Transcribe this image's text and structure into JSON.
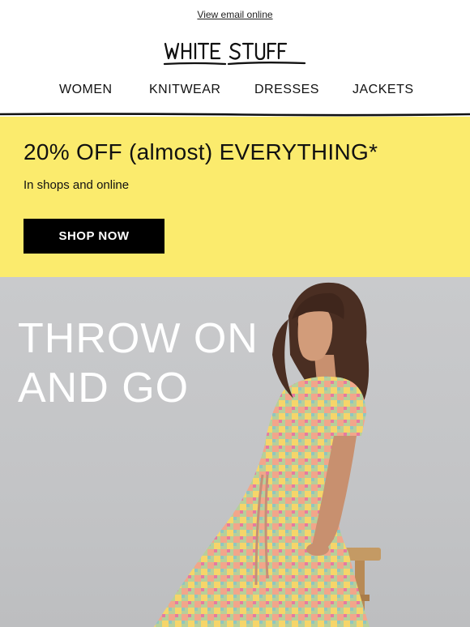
{
  "header": {
    "view_online": "View email online",
    "logo_text": "WHITE STUFF"
  },
  "nav": {
    "items": [
      "WOMEN",
      "KNITWEAR",
      "DRESSES",
      "JACKETS"
    ]
  },
  "promo": {
    "title": "20% OFF (almost) EVERYTHING*",
    "subtitle": "In shops and online",
    "cta": "SHOP NOW",
    "background": "#fbeb6d"
  },
  "hero": {
    "title_line1": "THROW ON",
    "title_line2": "AND GO"
  }
}
